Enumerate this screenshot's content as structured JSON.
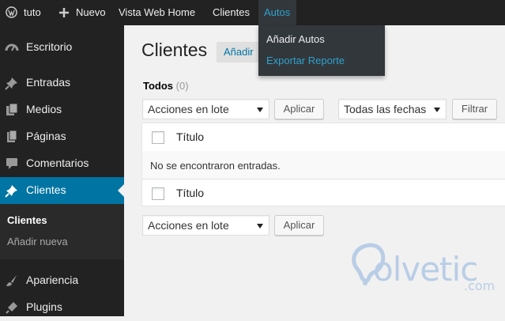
{
  "adminbar": {
    "site_name": "tuto",
    "new_label": "Nuevo",
    "items": [
      "Vista Web Home",
      "Clientes",
      "Autos"
    ]
  },
  "dropdown": {
    "items": [
      "Añadir Autos",
      "Exportar Reporte"
    ]
  },
  "sidebar": {
    "items": [
      {
        "label": "Escritorio",
        "icon": "dashboard-icon"
      },
      {
        "label": "Entradas",
        "icon": "pin-icon"
      },
      {
        "label": "Medios",
        "icon": "media-icon"
      },
      {
        "label": "Páginas",
        "icon": "pages-icon"
      },
      {
        "label": "Comentarios",
        "icon": "comment-icon"
      },
      {
        "label": "Clientes",
        "icon": "pin-icon"
      },
      {
        "label": "Apariencia",
        "icon": "brush-icon"
      },
      {
        "label": "Plugins",
        "icon": "plugin-icon"
      }
    ],
    "submenu": [
      "Clientes",
      "Añadir nueva"
    ]
  },
  "main": {
    "title": "Clientes",
    "add_new": "Añadir",
    "filter_all": "Todos",
    "filter_count": "(0)",
    "bulk_actions": "Acciones en lote",
    "apply": "Aplicar",
    "all_dates": "Todas las fechas",
    "filter_button": "Filtrar",
    "column_title": "Título",
    "no_items": "No se encontraron entradas."
  },
  "watermark": {
    "brand": "olvetic",
    "suffix": ".com"
  },
  "colors": {
    "accent": "#0074a2",
    "highlight": "#2ea2cc",
    "admin_bg": "#222222"
  }
}
